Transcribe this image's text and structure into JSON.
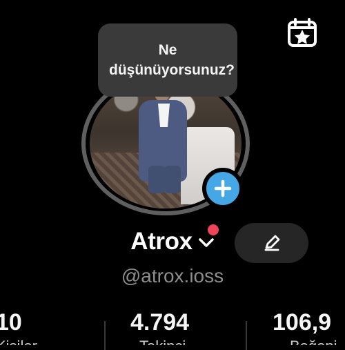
{
  "tooltip": {
    "text": "Ne düşünüyorsunuz?"
  },
  "profile": {
    "name": "Atrox",
    "username": "@atrox.ioss"
  },
  "stats": [
    {
      "value": "10",
      "label": "Kişiler"
    },
    {
      "value": "4.794",
      "label": "Takipçi"
    },
    {
      "value": "106,9",
      "label": "Beğeni"
    }
  ],
  "icons": {
    "calendar": "calendar-star-icon",
    "add": "plus-icon",
    "chevron": "chevron-down-icon",
    "edit": "pencil-icon",
    "notification": "red-dot-icon"
  },
  "colors": {
    "background": "#000000",
    "accent_blue": "#45a7e6",
    "notification_red": "#f0445b"
  }
}
